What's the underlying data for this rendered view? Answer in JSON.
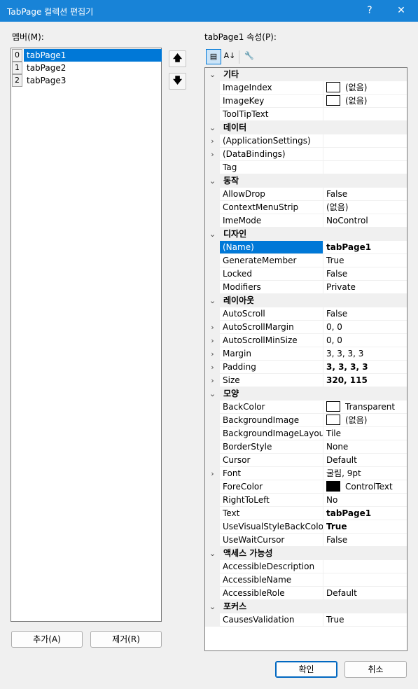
{
  "window": {
    "title": "TabPage 컬렉션 편집기",
    "help": "?",
    "close": "✕"
  },
  "members_label": "멤버(M):",
  "properties_label": "tabPage1 속성(P):",
  "members": [
    {
      "index": "0",
      "name": "tabPage1",
      "selected": true
    },
    {
      "index": "1",
      "name": "tabPage2",
      "selected": false
    },
    {
      "index": "2",
      "name": "tabPage3",
      "selected": false
    }
  ],
  "move_up": "🡅",
  "move_down": "🡇",
  "add_button": "추가(A)",
  "remove_button": "제거(R)",
  "ok_button": "확인",
  "cancel_button": "취소",
  "toolbar": {
    "categorized": "▤",
    "alphabetical": "A↓",
    "property_pages": "🔧"
  },
  "icons": {
    "collapse": "⌄",
    "expand": "›"
  },
  "colors": {
    "titlebar": "#1883d7",
    "selection": "#0078d7"
  },
  "grid": [
    {
      "type": "cat",
      "name": "기타"
    },
    {
      "type": "prop",
      "name": "ImageIndex",
      "value": "(없음)",
      "swatch": "white"
    },
    {
      "type": "prop",
      "name": "ImageKey",
      "value": "(없음)",
      "swatch": "white"
    },
    {
      "type": "prop",
      "name": "ToolTipText",
      "value": ""
    },
    {
      "type": "cat",
      "name": "데이터"
    },
    {
      "type": "prop",
      "name": "(ApplicationSettings)",
      "value": "",
      "expandable": true
    },
    {
      "type": "prop",
      "name": "(DataBindings)",
      "value": "",
      "expandable": true
    },
    {
      "type": "prop",
      "name": "Tag",
      "value": ""
    },
    {
      "type": "cat",
      "name": "동작"
    },
    {
      "type": "prop",
      "name": "AllowDrop",
      "value": "False"
    },
    {
      "type": "prop",
      "name": "ContextMenuStrip",
      "value": "(없음)"
    },
    {
      "type": "prop",
      "name": "ImeMode",
      "value": "NoControl"
    },
    {
      "type": "cat",
      "name": "디자인"
    },
    {
      "type": "prop",
      "name": "(Name)",
      "value": "tabPage1",
      "bold": true,
      "selected": true
    },
    {
      "type": "prop",
      "name": "GenerateMember",
      "value": "True"
    },
    {
      "type": "prop",
      "name": "Locked",
      "value": "False"
    },
    {
      "type": "prop",
      "name": "Modifiers",
      "value": "Private"
    },
    {
      "type": "cat",
      "name": "레이아웃"
    },
    {
      "type": "prop",
      "name": "AutoScroll",
      "value": "False"
    },
    {
      "type": "prop",
      "name": "AutoScrollMargin",
      "value": "0, 0",
      "expandable": true
    },
    {
      "type": "prop",
      "name": "AutoScrollMinSize",
      "value": "0, 0",
      "expandable": true
    },
    {
      "type": "prop",
      "name": "Margin",
      "value": "3, 3, 3, 3",
      "expandable": true
    },
    {
      "type": "prop",
      "name": "Padding",
      "value": "3, 3, 3, 3",
      "expandable": true,
      "bold": true
    },
    {
      "type": "prop",
      "name": "Size",
      "value": "320, 115",
      "expandable": true,
      "bold": true
    },
    {
      "type": "cat",
      "name": "모양"
    },
    {
      "type": "prop",
      "name": "BackColor",
      "value": "Transparent",
      "swatch": "white"
    },
    {
      "type": "prop",
      "name": "BackgroundImage",
      "value": "(없음)",
      "swatch": "white"
    },
    {
      "type": "prop",
      "name": "BackgroundImageLayout",
      "value": "Tile"
    },
    {
      "type": "prop",
      "name": "BorderStyle",
      "value": "None"
    },
    {
      "type": "prop",
      "name": "Cursor",
      "value": "Default"
    },
    {
      "type": "prop",
      "name": "Font",
      "value": "굴림, 9pt",
      "expandable": true
    },
    {
      "type": "prop",
      "name": "ForeColor",
      "value": "ControlText",
      "swatch": "black"
    },
    {
      "type": "prop",
      "name": "RightToLeft",
      "value": "No"
    },
    {
      "type": "prop",
      "name": "Text",
      "value": "tabPage1",
      "bold": true
    },
    {
      "type": "prop",
      "name": "UseVisualStyleBackColor",
      "value": "True",
      "bold": true
    },
    {
      "type": "prop",
      "name": "UseWaitCursor",
      "value": "False"
    },
    {
      "type": "cat",
      "name": "액세스 가능성"
    },
    {
      "type": "prop",
      "name": "AccessibleDescription",
      "value": ""
    },
    {
      "type": "prop",
      "name": "AccessibleName",
      "value": ""
    },
    {
      "type": "prop",
      "name": "AccessibleRole",
      "value": "Default"
    },
    {
      "type": "cat",
      "name": "포커스"
    },
    {
      "type": "prop",
      "name": "CausesValidation",
      "value": "True"
    }
  ]
}
